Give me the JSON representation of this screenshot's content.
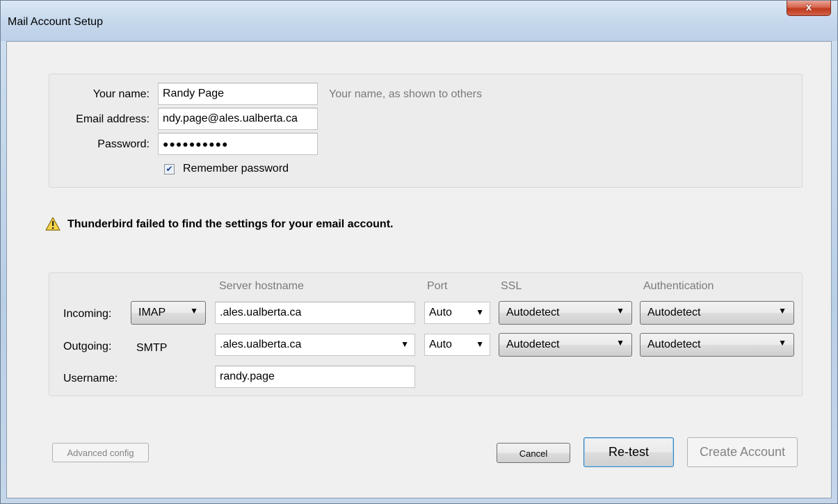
{
  "window": {
    "title": "Mail Account Setup",
    "close_label": "x"
  },
  "identity": {
    "name_label": "Your name:",
    "name_value": "Randy Page",
    "name_hint": "Your name, as shown to others",
    "email_label": "Email address:",
    "email_value": "ndy.page@ales.ualberta.ca",
    "password_label": "Password:",
    "password_value": "●●●●●●●●●●",
    "remember_label": "Remember password",
    "remember_checked": true
  },
  "warning": {
    "icon": "warning-icon",
    "text": "Thunderbird failed to find the settings for your email account."
  },
  "server": {
    "headers": {
      "hostname": "Server hostname",
      "port": "Port",
      "ssl": "SSL",
      "auth": "Authentication"
    },
    "incoming_label": "Incoming:",
    "incoming_protocol": "IMAP",
    "incoming_host": ".ales.ualberta.ca",
    "incoming_port": "Auto",
    "incoming_ssl": "Autodetect",
    "incoming_auth": "Autodetect",
    "outgoing_label": "Outgoing:",
    "outgoing_protocol": "SMTP",
    "outgoing_host": ".ales.ualberta.ca",
    "outgoing_port": "Auto",
    "outgoing_ssl": "Autodetect",
    "outgoing_auth": "Autodetect",
    "username_label": "Username:",
    "username_value": "randy.page"
  },
  "buttons": {
    "advanced": "Advanced config",
    "cancel": "Cancel",
    "retest": "Re-test",
    "create": "Create Account"
  }
}
